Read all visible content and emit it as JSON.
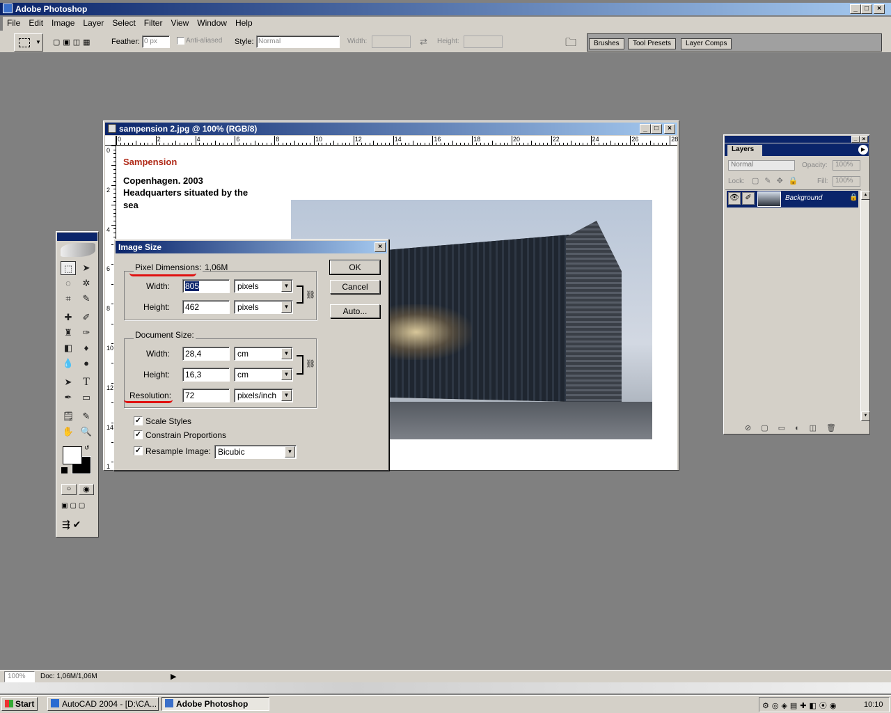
{
  "app": {
    "title": "Adobe Photoshop"
  },
  "menu": [
    "File",
    "Edit",
    "Image",
    "Layer",
    "Select",
    "Filter",
    "View",
    "Window",
    "Help"
  ],
  "options": {
    "feather_label": "Feather:",
    "feather_value": "0 px",
    "antialiased_label": "Anti-aliased",
    "style_label": "Style:",
    "style_value": "Normal",
    "width_label": "Width:",
    "height_label": "Height:"
  },
  "palette_tabs": [
    "Brushes",
    "Tool Presets",
    "Layer Comps"
  ],
  "document": {
    "title": "sampension 2.jpg @ 100% (RGB/8)",
    "heading": "Sampension",
    "line1": "Copenhagen. 2003",
    "line2": "Headquarters situated by the",
    "line3": "sea",
    "ruler_h": [
      "0",
      "2",
      "4",
      "6",
      "8",
      "10",
      "12",
      "14",
      "16",
      "18",
      "20",
      "22",
      "24",
      "26",
      "28"
    ],
    "ruler_v": [
      "0",
      "2",
      "4",
      "6",
      "8",
      "10",
      "12",
      "14",
      "1"
    ]
  },
  "dialog": {
    "title": "Image Size",
    "pixel_dimensions_label": "Pixel Dimensions:",
    "pixel_dimensions_value": "1,06M",
    "width_label": "Width:",
    "height_label": "Height:",
    "pixel_width": "805",
    "pixel_height": "462",
    "pixel_unit": "pixels",
    "document_size_label": "Document Size:",
    "doc_width": "28,4",
    "doc_height": "16,3",
    "doc_unit": "cm",
    "resolution_label": "Resolution:",
    "resolution_value": "72",
    "resolution_unit": "pixels/inch",
    "scale_styles": "Scale Styles",
    "constrain": "Constrain Proportions",
    "resample": "Resample Image:",
    "resample_value": "Bicubic",
    "ok": "OK",
    "cancel": "Cancel",
    "auto": "Auto..."
  },
  "layers": {
    "tab": "Layers",
    "blend": "Normal",
    "opacity_label": "Opacity:",
    "opacity_value": "100%",
    "lock_label": "Lock:",
    "fill_label": "Fill:",
    "fill_value": "100%",
    "layer_name": "Background"
  },
  "status": {
    "zoom": "100%",
    "doc": "Doc: 1,06M/1,06M"
  },
  "taskbar": {
    "start": "Start",
    "task1": "AutoCAD 2004 - [D:\\CA...",
    "task2": "Adobe Photoshop",
    "clock": "10:10"
  }
}
